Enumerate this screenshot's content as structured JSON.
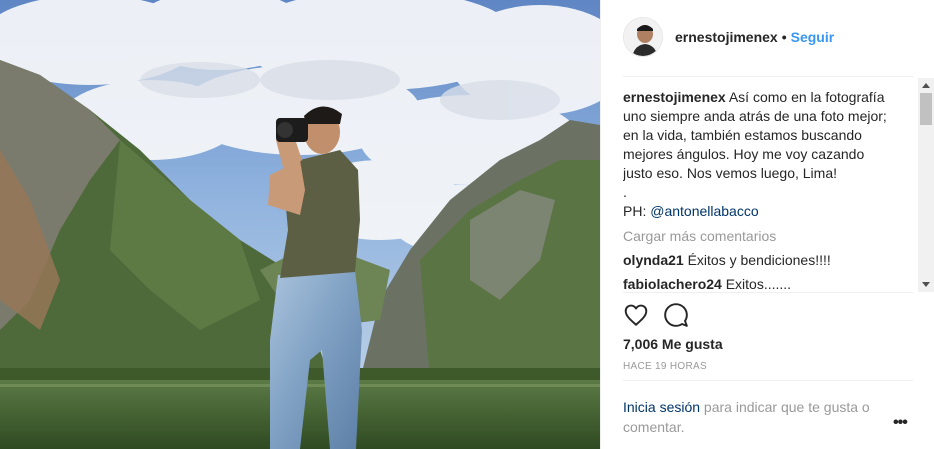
{
  "post": {
    "author": "ernestojimenex",
    "separator": "•",
    "follow_label": "Seguir",
    "caption": {
      "user": "ernestojimenex",
      "text": "Así como en la fotografía uno siempre anda atrás de una foto mejor; en la vida, también estamos buscando mejores ángulos. Hoy me voy cazando justo eso. Nos vemos luego, Lima!",
      "dot_line": ".",
      "ph_prefix": "PH: ",
      "mention": "@antonellabacco"
    },
    "load_more": "Cargar más comentarios",
    "comments": [
      {
        "user": "olynda21",
        "text": "Éxitos y bendiciones!!!!"
      },
      {
        "user": "fabiolachero24",
        "text": "Exitos......."
      }
    ],
    "likes": "7,006 Me gusta",
    "timestamp": "HACE 19 HORAS",
    "login_link": "Inicia sesión",
    "login_text": " para indicar que te gusta o comentar.",
    "options_icon": "•••"
  },
  "icons": {
    "like": "heart-icon",
    "comment": "comment-bubble-icon",
    "options": "more-options-icon"
  },
  "colors": {
    "link_blue": "#3897f0",
    "mention_blue": "#003569",
    "muted": "#999999",
    "text": "#262626"
  }
}
